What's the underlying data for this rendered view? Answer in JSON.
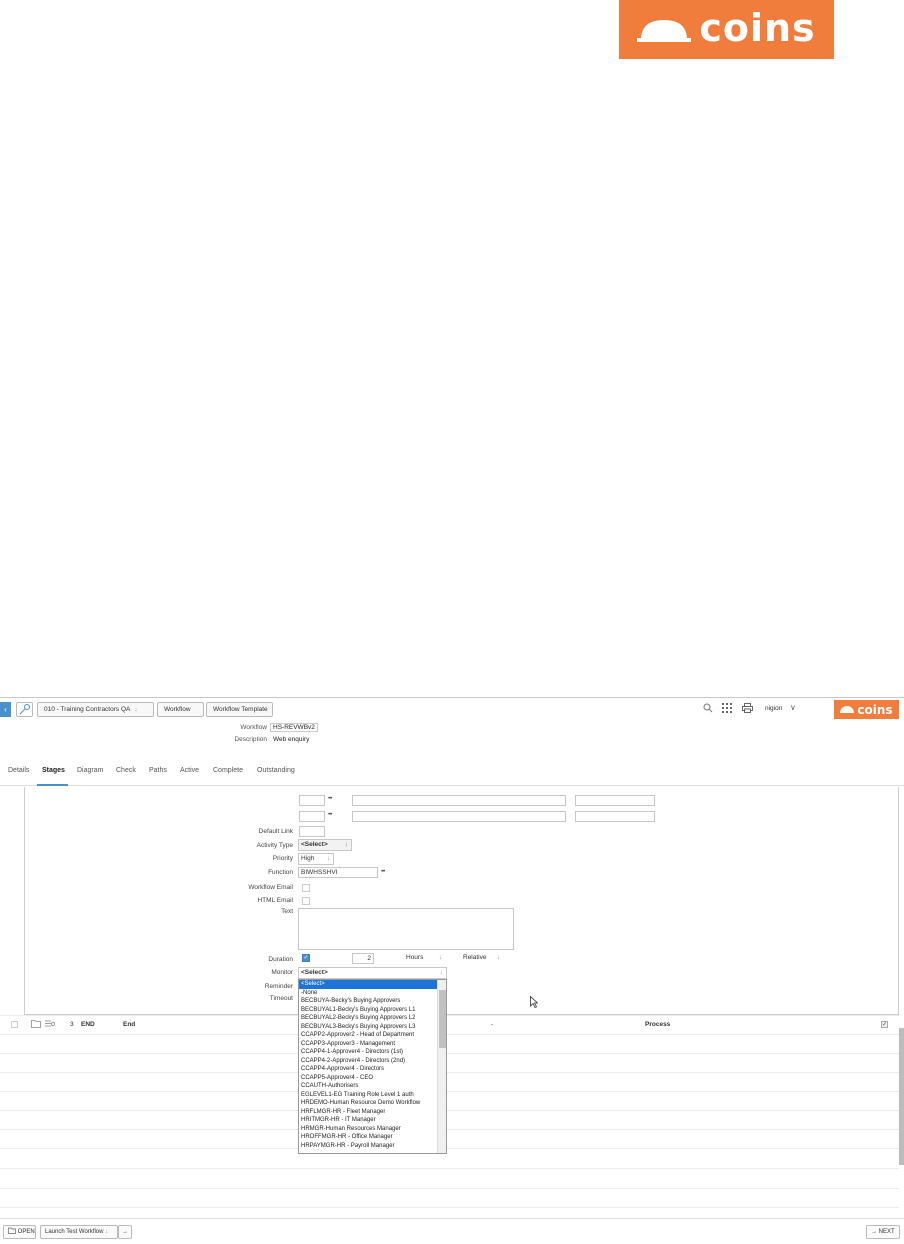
{
  "brand": {
    "logo_text": "coins",
    "color": "#f07d3c"
  },
  "topbar": {
    "back_icon": "back-arrow-icon",
    "breadcrumbs": [
      "010 - Training Contractors QA",
      "Workflow",
      "Workflow Template"
    ],
    "workflow_label": "Workflow",
    "workflow_value": "HS-REVWBv2",
    "description_label": "Description",
    "description_value": "Web enquiry",
    "user": "nigion",
    "icons": [
      "search-icon",
      "apps-grid-icon",
      "print-icon"
    ]
  },
  "tabs": [
    "Details",
    "Stages",
    "Diagram",
    "Check",
    "Paths",
    "Active",
    "Complete",
    "Outstanding"
  ],
  "active_tab": "Stages",
  "form": {
    "default_link_label": "Default Link",
    "activity_type_label": "Activity Type",
    "activity_type_value": "<Select>",
    "priority_label": "Priority",
    "priority_value": "High",
    "function_label": "Function",
    "function_value": "BIWHSSHVI",
    "dots": "•••",
    "workflow_email_label": "Workflow Email",
    "html_email_label": "HTML Email",
    "text_label": "Text",
    "duration_label": "Duration",
    "duration_checked": true,
    "duration_value": "2",
    "duration_unit": "Hours",
    "duration_mode": "Relative",
    "monitor_label": "Monitor",
    "monitor_value": "<Select>",
    "reminder_label": "Reminder",
    "timeout_label": "Timeout"
  },
  "monitor_options": [
    "<Select>",
    "-None",
    "BECBUYA-Becky's Buying Approvers",
    "BECBUYAL1-Becky's Buying Approvers L1",
    "BECBUYAL2-Becky's Buying Approvers L2",
    "BECBUYAL3-Becky's Buying Approvers L3",
    "CCAPP2-Approver2 - Head of Department",
    "CCAPP3-Approver3 - Management",
    "CCAPP4-1-Approver4 - Directors (1st)",
    "CCAPP4-2-Approver4 - Directors (2nd)",
    "CCAPP4-Approver4 - Directors",
    "CCAPP5-Approver4 - CEO",
    "CCAUTH-Authorisers",
    "EGLEVEL1-EG Training Role Level 1 auth",
    "HRDEMO-Human Resource Demo Workflow",
    "HRFLMGR-HR - Fleet Manager",
    "HRITMGR-HR - IT Manager",
    "HRMGR-Human Resources Manager",
    "HROFFMGR-HR - Office Manager",
    "HRPAYMGR-HR - Payroll Manager"
  ],
  "end_row": {
    "num": "3",
    "code": "END",
    "name": "End",
    "dash": "-",
    "type": "Process"
  },
  "bottom": {
    "open_label": "OPEN",
    "launch_label": "Launch Test Workflow",
    "next_label": "NEXT"
  }
}
